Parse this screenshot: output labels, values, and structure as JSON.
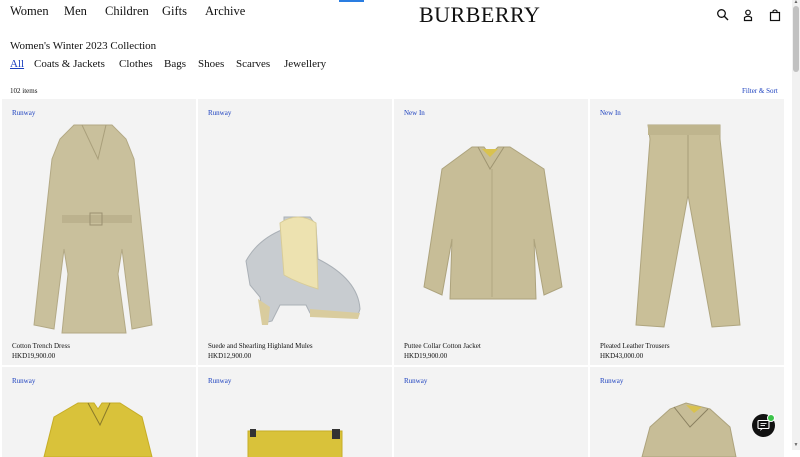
{
  "nav": {
    "women": "Women",
    "men": "Men",
    "children": "Children",
    "gifts": "Gifts",
    "archive": "Archive"
  },
  "brand": {
    "logo": "BURBERRY"
  },
  "header_icons": [
    "search-icon",
    "account-icon",
    "bag-icon"
  ],
  "collection": {
    "title": "Women's Winter 2023 Collection",
    "categories": [
      "All",
      "Coats & Jackets",
      "Clothes",
      "Bags",
      "Shoes",
      "Scarves",
      "Jewellery"
    ],
    "active_category": "All"
  },
  "listing": {
    "count": "102 items",
    "filter_label": "Filter & Sort"
  },
  "products": [
    {
      "badge": "Runway",
      "name": "Cotton Trench Dress",
      "price": "HKD19,900.00"
    },
    {
      "badge": "Runway",
      "name": "Suede and Shearling Highland Mules",
      "price": "HKD12,900.00"
    },
    {
      "badge": "New In",
      "name": "Puttee Collar Cotton Jacket",
      "price": "HKD19,900.00"
    },
    {
      "badge": "New In",
      "name": "Pleated Leather Trousers",
      "price": "HKD43,000.00"
    },
    {
      "badge": "Runway"
    },
    {
      "badge": "Runway"
    },
    {
      "badge": "Runway"
    },
    {
      "badge": "Runway"
    }
  ],
  "colors": {
    "accent": "#1a3fbf",
    "card_bg": "#f3f3f3",
    "chat_bg": "#111111",
    "online": "#3cc34a"
  }
}
